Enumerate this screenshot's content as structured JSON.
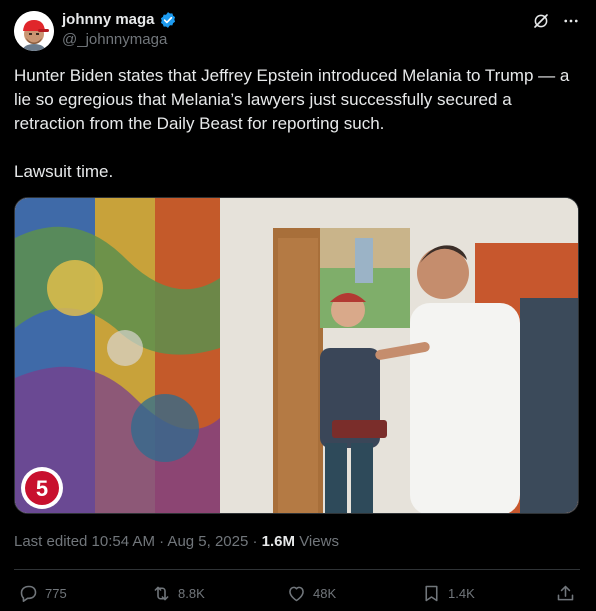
{
  "author": {
    "display_name": "johnny maga",
    "handle": "@_johnnymaga",
    "verified": true,
    "verified_color": "#1d9bf0",
    "avatar_icon": "cartoon-avatar-red-cap"
  },
  "header_icons": [
    "grok-icon",
    "more-icon"
  ],
  "tweet": {
    "text": "Hunter Biden states that Jeffrey Epstein introduced Melania to Trump — a lie so egregious that Melania’s lawyers just successfully secured a retraction from the Daily Beast for reporting such.\n\nLawsuit time."
  },
  "media": {
    "watermark_logo": "5",
    "description_icon": "video-thumbnail"
  },
  "meta": {
    "edited_label": "Last edited 10:54 AM · Aug 5, 2025 · ",
    "views_count": "1.6M",
    "views_label": " Views"
  },
  "actions": {
    "reply": {
      "icon": "reply-icon",
      "count": "775"
    },
    "repost": {
      "icon": "repost-icon",
      "count": "8.8K"
    },
    "like": {
      "icon": "like-icon",
      "count": "48K"
    },
    "bookmark": {
      "icon": "bookmark-icon",
      "count": "1.4K"
    },
    "share": {
      "icon": "share-icon"
    }
  },
  "colors": {
    "background": "#000000",
    "text": "#e7e9ea",
    "secondary_text": "#71767b",
    "border": "#2f3336"
  }
}
